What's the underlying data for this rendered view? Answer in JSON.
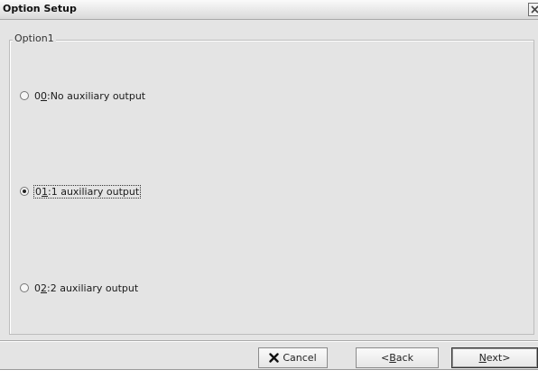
{
  "window": {
    "title": "Option Setup",
    "close_icon": "close-icon"
  },
  "group": {
    "legend": "Option1"
  },
  "options": [
    {
      "code": "00",
      "code_prefix": "0",
      "code_mnemonic": "0",
      "text": ":No auxiliary output",
      "selected": false
    },
    {
      "code": "01",
      "code_prefix": "0",
      "code_mnemonic": "1",
      "text": ":1 auxiliary output",
      "selected": true
    },
    {
      "code": "02",
      "code_prefix": "0",
      "code_mnemonic": "2",
      "text": ":2 auxiliary output",
      "selected": false
    }
  ],
  "buttons": {
    "cancel": {
      "label": "Cancel",
      "icon": "x-icon"
    },
    "back": {
      "prefix": "<",
      "mnemonic": "B",
      "rest": "ack"
    },
    "next": {
      "mnemonic": "N",
      "rest": "ext>"
    }
  }
}
